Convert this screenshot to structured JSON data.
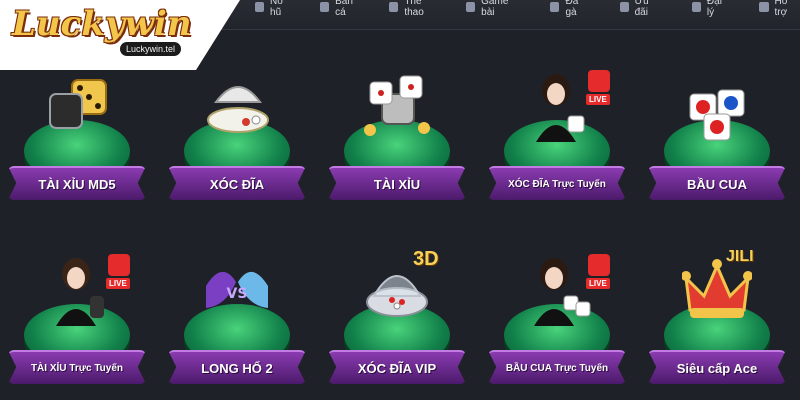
{
  "brand": {
    "name": "Luckywin",
    "domain": "Luckywin.tel"
  },
  "nav": [
    {
      "label": "Nổ hũ",
      "icon": "slot-icon"
    },
    {
      "label": "Bắn cá",
      "icon": "fish-icon"
    },
    {
      "label": "Thể thao",
      "icon": "sports-icon"
    },
    {
      "label": "Game bài",
      "icon": "cards-icon"
    },
    {
      "label": "Đá gà",
      "icon": "rooster-icon"
    },
    {
      "label": "Ưu đãi",
      "icon": "gift-icon"
    },
    {
      "label": "Đại lý",
      "icon": "agent-icon"
    },
    {
      "label": "Hỗ trợ",
      "icon": "support-icon"
    }
  ],
  "games": [
    {
      "label": "TÀI XỈU MD5",
      "live": false
    },
    {
      "label": "XÓC ĐĨA",
      "live": false
    },
    {
      "label": "TÀI XỈU",
      "live": false
    },
    {
      "label": "XÓC ĐĨA Trực Tuyến",
      "live": true
    },
    {
      "label": "BẦU CUA",
      "live": false
    },
    {
      "label": "TÀI XỈU Trực Tuyến",
      "live": true
    },
    {
      "label": "LONG HỔ 2",
      "live": false
    },
    {
      "label": "XÓC ĐĨA VIP",
      "live": false
    },
    {
      "label": "BẦU CUA Trực Tuyến",
      "live": true
    },
    {
      "label": "Siêu cấp Ace",
      "live": false
    }
  ],
  "badges": {
    "tag_3d": "3D",
    "tag_jili": "JILI",
    "live": "LIVE"
  },
  "colors": {
    "background": "#1f2128",
    "banner": "#6b2a93",
    "pedestal": "#2ea862",
    "gold": "#f7d25a"
  }
}
